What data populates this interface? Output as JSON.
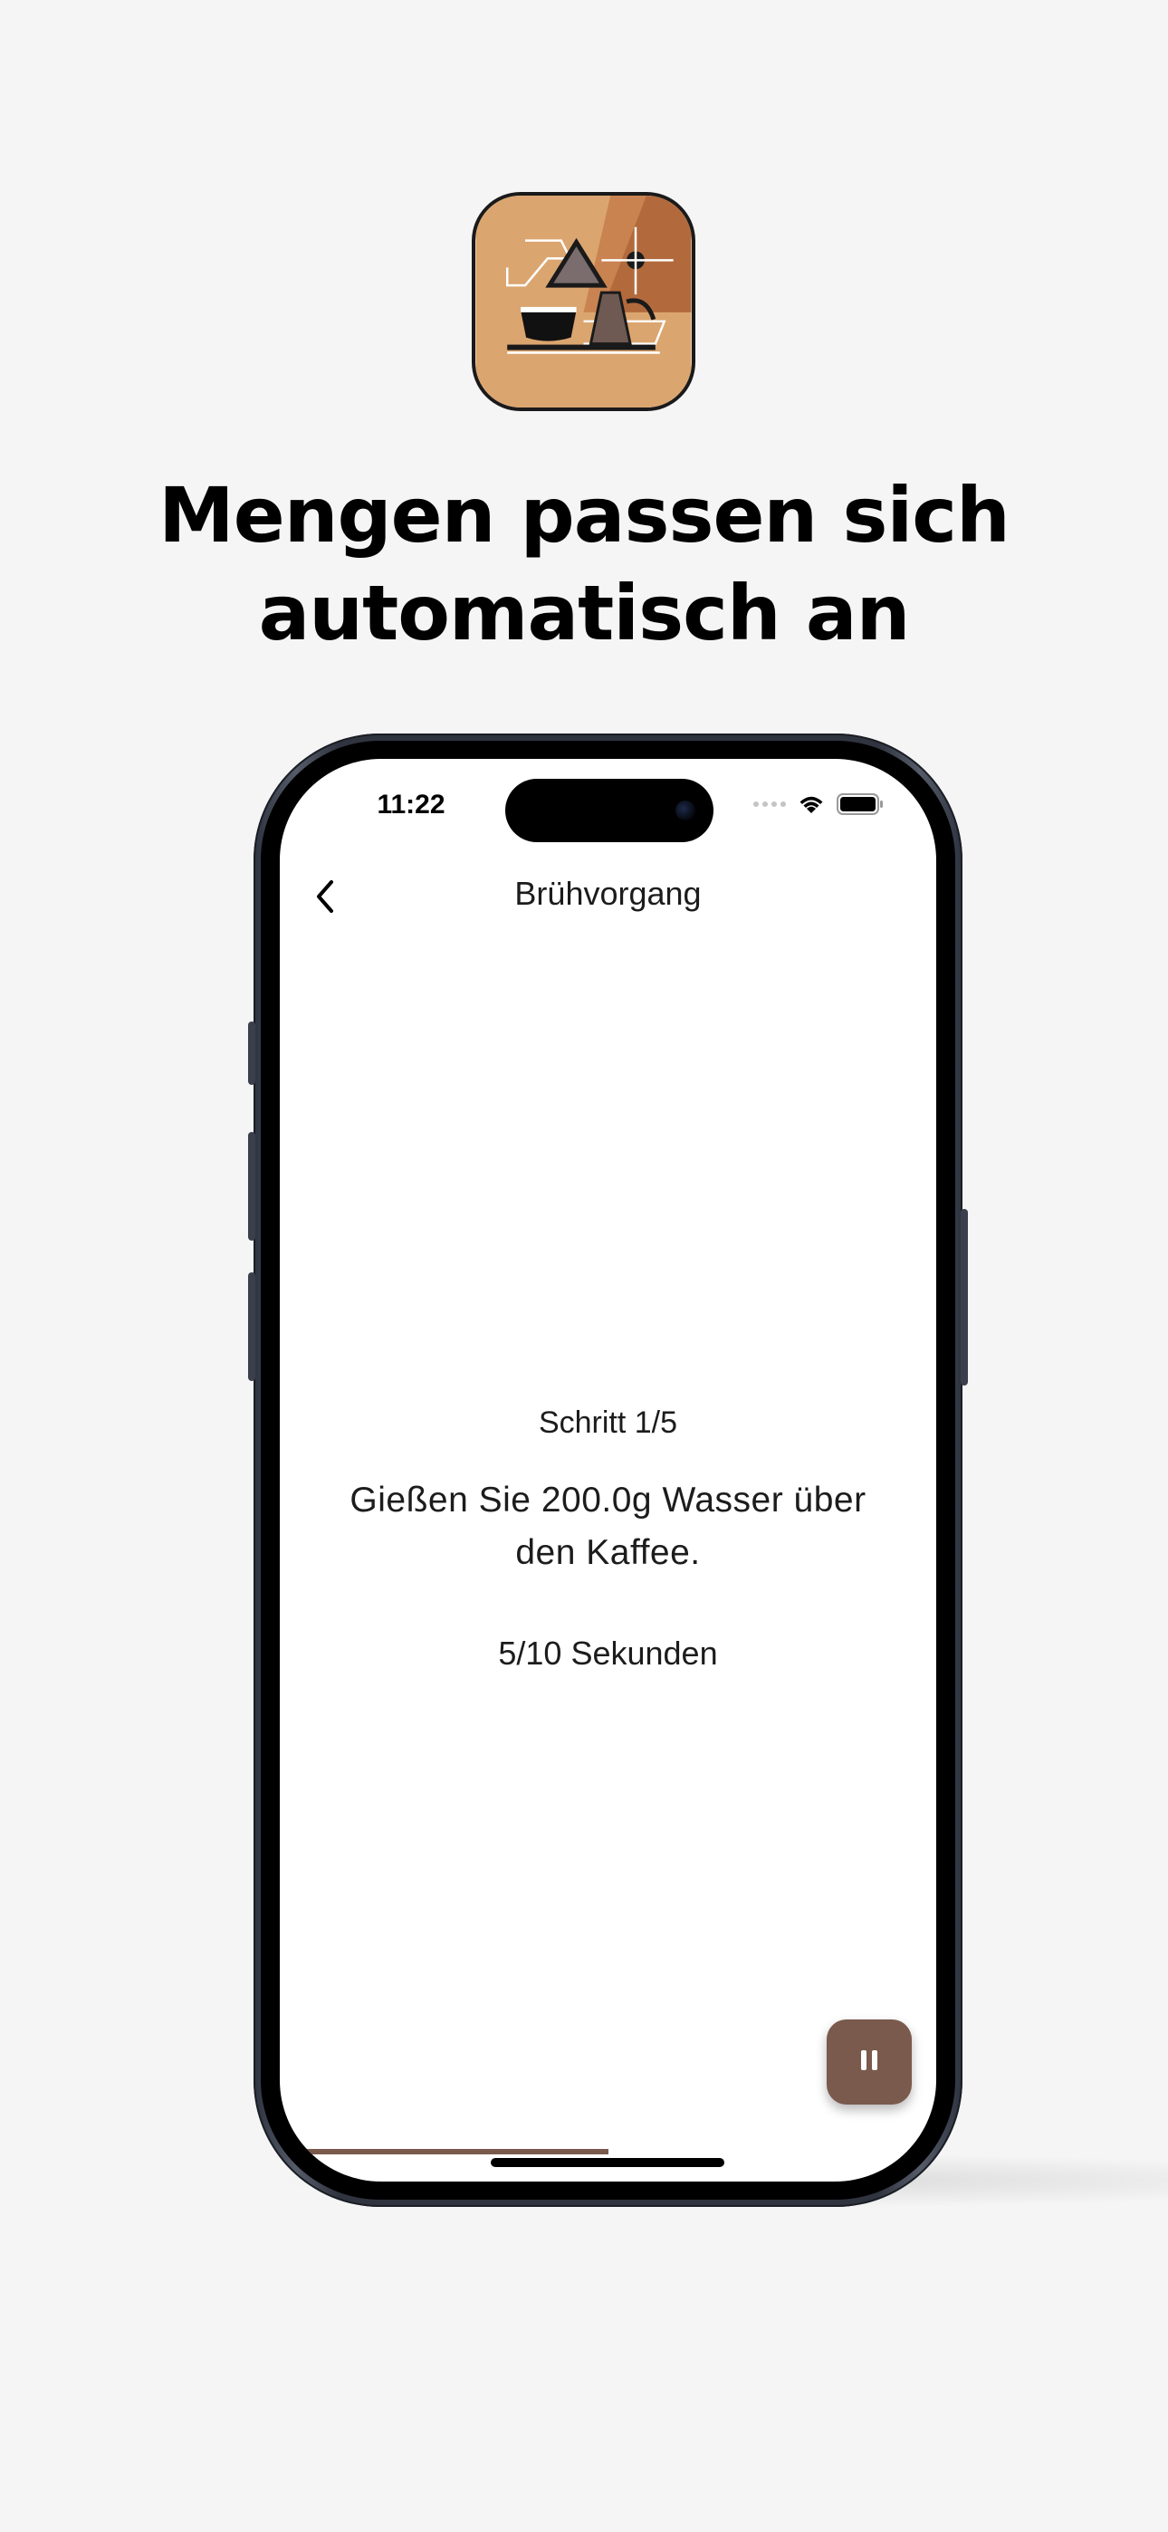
{
  "headline": {
    "line1": "Mengen passen sich",
    "line2": "automatisch an"
  },
  "app_icon": {
    "name": "coffee-brewing-app-icon",
    "colors": {
      "background": "#d9a06b",
      "accent": "#b36a3b",
      "outline": "#1a1a1a"
    }
  },
  "status_bar": {
    "time": "11:22",
    "icons": [
      "signal-dots-icon",
      "wifi-icon",
      "battery-icon"
    ]
  },
  "nav": {
    "back_icon": "chevron-left-icon",
    "title": "Brühvorgang"
  },
  "brew": {
    "step_label": "Schritt 1/5",
    "instruction": "Gießen Sie 200.0g Wasser über den Kaffee.",
    "timer": "5/10 Sekunden",
    "progress_fraction": 0.5
  },
  "fab": {
    "icon": "pause-icon",
    "color": "#7a5a4c"
  }
}
